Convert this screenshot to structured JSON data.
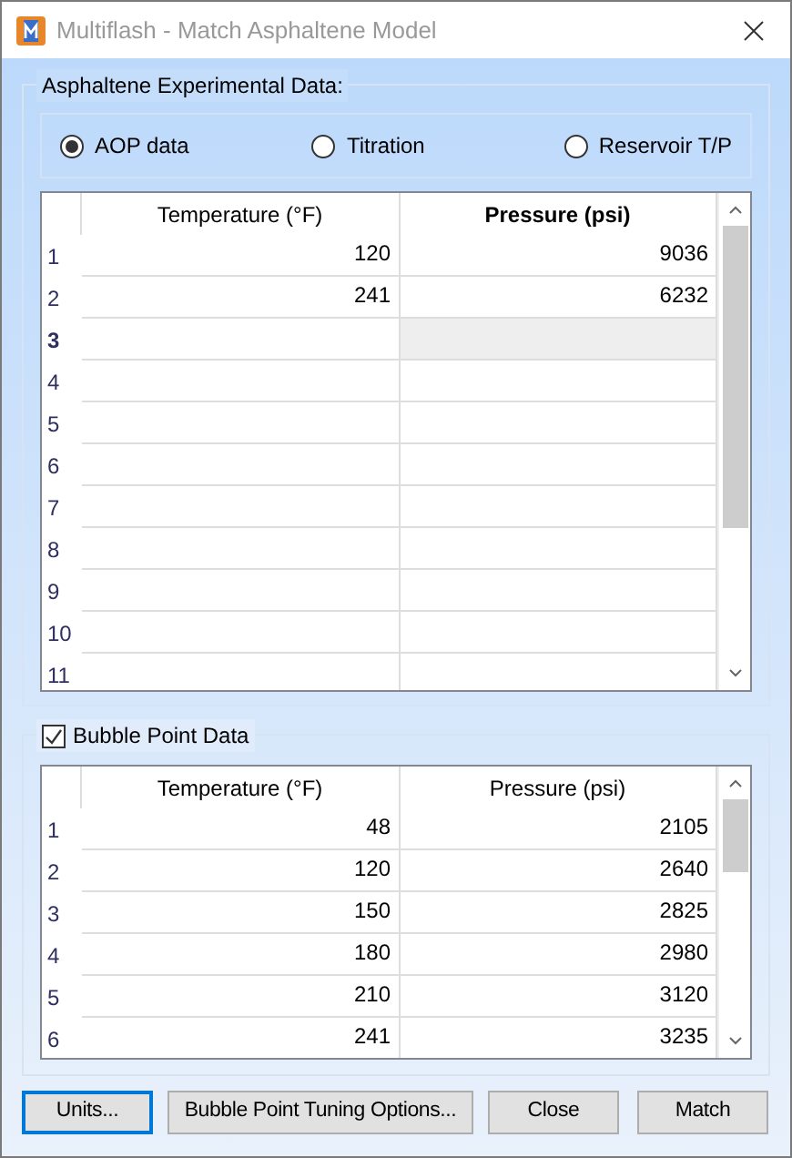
{
  "window": {
    "title": "Multiflash - Match Asphaltene Model"
  },
  "asphaltene_group": {
    "label": "Asphaltene Experimental Data:",
    "options": [
      {
        "label": "AOP data",
        "selected": true
      },
      {
        "label": "Titration",
        "selected": false
      },
      {
        "label": "Reservoir T/P",
        "selected": false
      }
    ],
    "table": {
      "columns": [
        {
          "label": "Temperature (°F)",
          "selected": false
        },
        {
          "label": "Pressure (psi)",
          "selected": true
        }
      ],
      "rows": [
        {
          "number": "1",
          "selected": false,
          "cells": [
            "120",
            "9036"
          ]
        },
        {
          "number": "2",
          "selected": false,
          "cells": [
            "241",
            "6232"
          ]
        },
        {
          "number": "3",
          "selected": true
        },
        {
          "number": "4",
          "selected": false
        },
        {
          "number": "5",
          "selected": false
        },
        {
          "number": "6",
          "selected": false
        },
        {
          "number": "7",
          "selected": false
        },
        {
          "number": "8",
          "selected": false
        },
        {
          "number": "9",
          "selected": false
        },
        {
          "number": "10",
          "selected": false
        },
        {
          "number": "11",
          "selected": false
        }
      ]
    }
  },
  "bubble_group": {
    "label": "Bubble Point Data",
    "checked": true,
    "table": {
      "columns": [
        {
          "label": "Temperature (°F)",
          "selected": false
        },
        {
          "label": "Pressure (psi)",
          "selected": false
        }
      ],
      "rows": [
        {
          "number": "1",
          "selected": false,
          "cells": [
            "48",
            "2105"
          ]
        },
        {
          "number": "2",
          "selected": false,
          "cells": [
            "120",
            "2640"
          ]
        },
        {
          "number": "3",
          "selected": false,
          "cells": [
            "150",
            "2825"
          ]
        },
        {
          "number": "4",
          "selected": false,
          "cells": [
            "180",
            "2980"
          ]
        },
        {
          "number": "5",
          "selected": false,
          "cells": [
            "210",
            "3120"
          ]
        },
        {
          "number": "6",
          "selected": false,
          "cells": [
            "241",
            "3235"
          ]
        }
      ]
    }
  },
  "buttons": [
    {
      "label": "Units...",
      "focused": true
    },
    {
      "label": "Bubble Point Tuning Options...",
      "focused": false
    },
    {
      "label": "Close",
      "focused": false
    },
    {
      "label": "Match",
      "focused": false
    }
  ]
}
